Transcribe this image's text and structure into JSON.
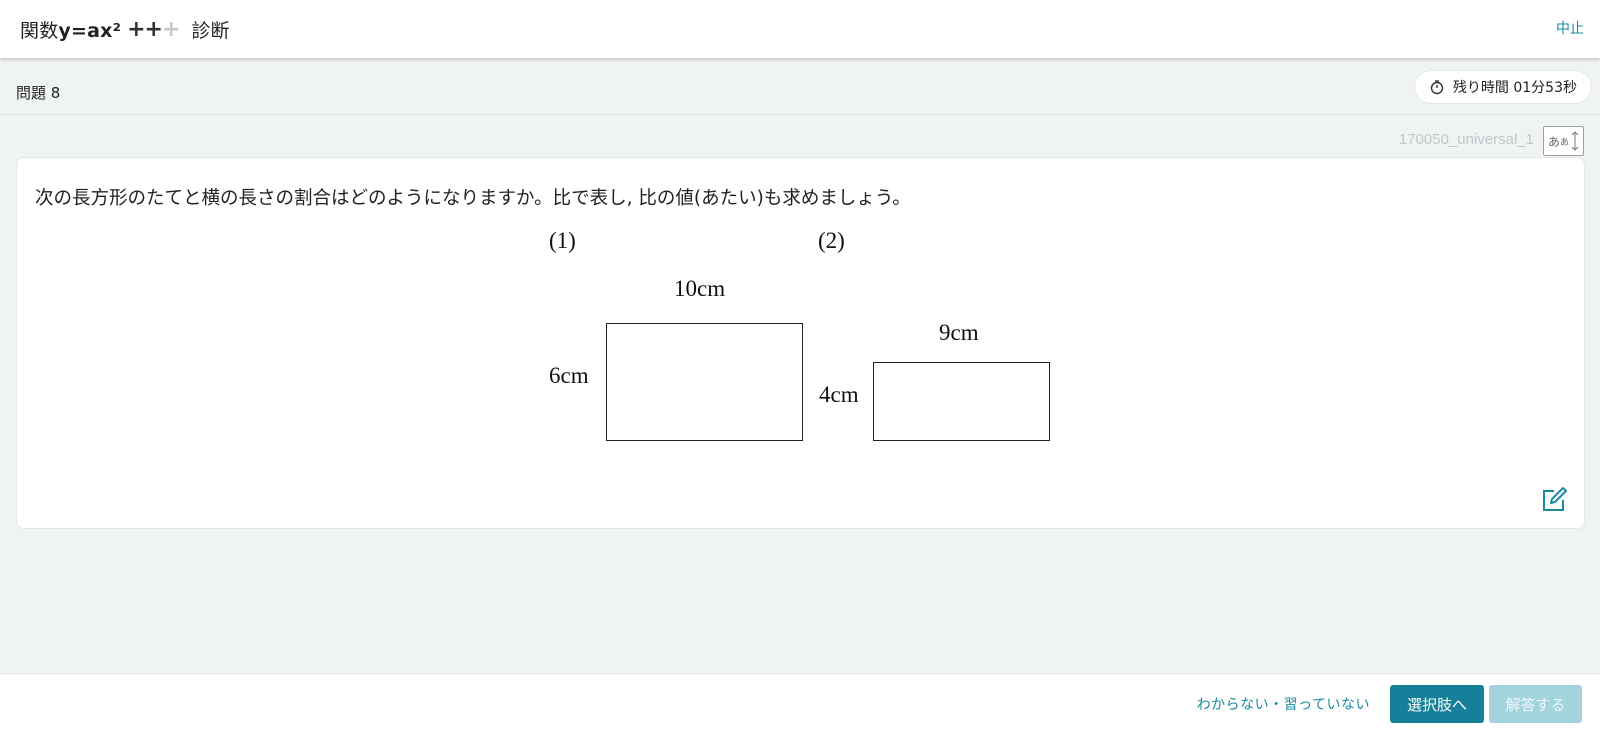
{
  "header": {
    "title_prefix": "関数",
    "title_formula": "y=ax²",
    "plus_on": "++",
    "plus_off": "+",
    "subtitle": "診断",
    "quit_label": "中止"
  },
  "question_bar": {
    "question_number": "問題 8",
    "timer_label": "残り時間 01分53秒"
  },
  "toolbar": {
    "content_code": "170050_universal_1",
    "font_size_label_large": "あ",
    "font_size_label_small": "あ"
  },
  "question": {
    "text": "次の長方形のたてと横の長さの割合はどのようになりますか。比で表し, 比の値(あたい)も求めましょう。",
    "figure1": {
      "label": "(1)",
      "width_label": "10cm",
      "height_label": "6cm"
    },
    "figure2": {
      "label": "(2)",
      "width_label": "9cm",
      "height_label": "4cm"
    }
  },
  "footer": {
    "unknown_label": "わからない・習っていない",
    "choices_label": "選択肢へ",
    "answer_label": "解答する"
  },
  "colors": {
    "accent": "#16809a",
    "link": "#1a8aa3",
    "disabled_button": "#a3d3dd",
    "background": "#f0f3f4"
  },
  "icons": [
    "timer-icon",
    "font-size-icon",
    "edit-memo-icon"
  ]
}
